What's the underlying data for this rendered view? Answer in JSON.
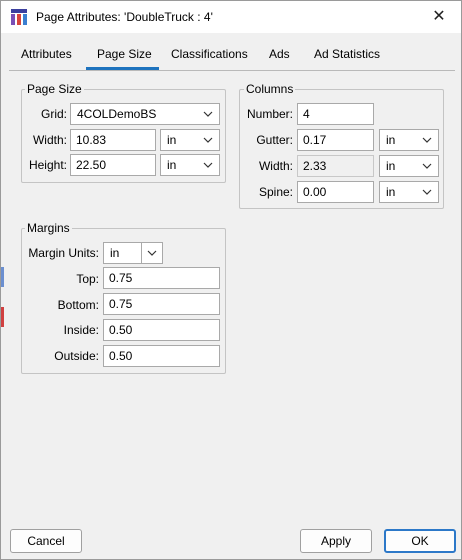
{
  "window": {
    "title": "Page Attributes: 'DoubleTruck : 4'",
    "close_glyph": "✕"
  },
  "tabs": [
    {
      "label": "Attributes",
      "selected": false
    },
    {
      "label": "Page Size",
      "selected": true
    },
    {
      "label": "Classifications",
      "selected": false
    },
    {
      "label": "Ads",
      "selected": false
    },
    {
      "label": "Ad Statistics",
      "selected": false
    }
  ],
  "page_size": {
    "group_title": "Page Size",
    "grid_label": "Grid:",
    "grid_value": "4COLDemoBS",
    "width_label": "Width:",
    "width_value": "10.83",
    "width_unit": "in",
    "height_label": "Height:",
    "height_value": "22.50",
    "height_unit": "in"
  },
  "columns": {
    "group_title": "Columns",
    "number_label": "Number:",
    "number_value": "4",
    "gutter_label": "Gutter:",
    "gutter_value": "0.17",
    "gutter_unit": "in",
    "width_label": "Width:",
    "width_value": "2.33",
    "width_unit": "in",
    "spine_label": "Spine:",
    "spine_value": "0.00",
    "spine_unit": "in"
  },
  "margins": {
    "group_title": "Margins",
    "units_label": "Margin Units:",
    "units_value": "in",
    "top_label": "Top:",
    "top_value": "0.75",
    "bottom_label": "Bottom:",
    "bottom_value": "0.75",
    "inside_label": "Inside:",
    "inside_value": "0.50",
    "outside_label": "Outside:",
    "outside_value": "0.50"
  },
  "buttons": {
    "cancel": "Cancel",
    "apply": "Apply",
    "ok": "OK"
  },
  "colors": {
    "accent": "#1e73be",
    "window_bg": "#f0f0f0",
    "field_bg": "#ffffff"
  },
  "icons": {
    "app": "page-attributes-app-icon",
    "close": "close-icon",
    "dropdown": "chevron-down-icon"
  }
}
